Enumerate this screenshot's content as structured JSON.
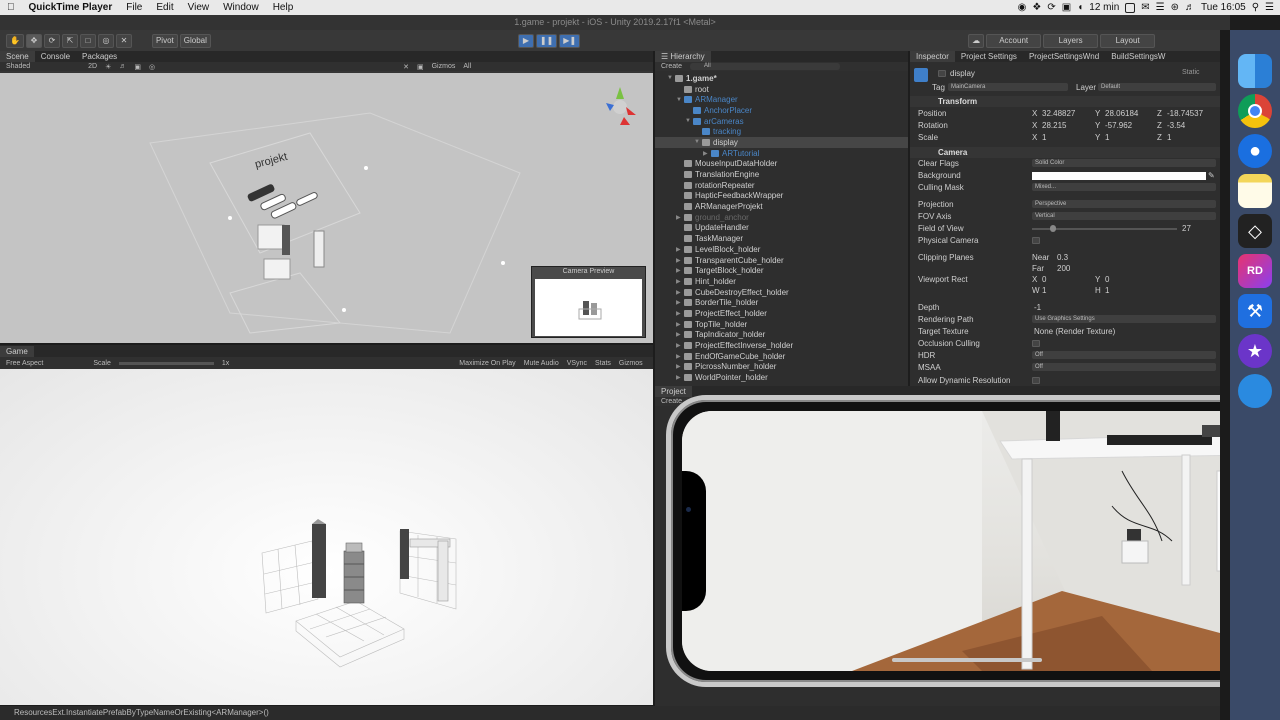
{
  "menubar": {
    "app": "QuickTime Player",
    "items": [
      "File",
      "Edit",
      "View",
      "Window",
      "Help"
    ],
    "status": {
      "timer": "12 min",
      "time": "Tue 16:05"
    }
  },
  "window_title": "1.game - projekt - iOS - Unity 2019.2.17f1 <Metal>",
  "toolbar": {
    "pivot": "Pivot",
    "global": "Global",
    "account": "Account",
    "layers": "Layers",
    "layout": "Layout"
  },
  "scene_panel": {
    "tabs": [
      "Scene",
      "Console",
      "Packages"
    ],
    "shading": "Shaded",
    "mode2d": "2D",
    "gizmos": "Gizmos",
    "all": "All",
    "camera_preview": "Camera Preview",
    "sign_text": "projekt"
  },
  "game_panel": {
    "tab": "Game",
    "aspect": "Free Aspect",
    "scale_label": "Scale",
    "scale_value": "1x",
    "options": [
      "Maximize On Play",
      "Mute Audio",
      "VSync",
      "Stats",
      "Gizmos"
    ]
  },
  "hierarchy": {
    "tab": "Hierarchy",
    "create": "Create",
    "search": "All",
    "rows": [
      {
        "label": "1.game*",
        "indent": 0,
        "style": "head",
        "arrow": "▼"
      },
      {
        "label": "root",
        "indent": 1,
        "style": "",
        "arrow": ""
      },
      {
        "label": "ARManager",
        "indent": 1,
        "style": "blue",
        "arrow": "▼"
      },
      {
        "label": "AnchorPlacer",
        "indent": 2,
        "style": "blue",
        "arrow": ""
      },
      {
        "label": "arCameras",
        "indent": 2,
        "style": "blue",
        "arrow": "▼"
      },
      {
        "label": "tracking",
        "indent": 3,
        "style": "blue",
        "arrow": ""
      },
      {
        "label": "display",
        "indent": 3,
        "style": "sel",
        "arrow": "▼"
      },
      {
        "label": "ARTutorial",
        "indent": 4,
        "style": "blue",
        "arrow": "▶"
      },
      {
        "label": "MouseInputDataHolder",
        "indent": 1,
        "style": "",
        "arrow": ""
      },
      {
        "label": "TranslationEngine",
        "indent": 1,
        "style": "",
        "arrow": ""
      },
      {
        "label": "rotationRepeater",
        "indent": 1,
        "style": "",
        "arrow": ""
      },
      {
        "label": "HapticFeedbackWrapper",
        "indent": 1,
        "style": "",
        "arrow": ""
      },
      {
        "label": "ARManagerProjekt",
        "indent": 1,
        "style": "",
        "arrow": ""
      },
      {
        "label": "ground_anchor",
        "indent": 1,
        "style": "dim",
        "arrow": "▶"
      },
      {
        "label": "UpdateHandler",
        "indent": 1,
        "style": "",
        "arrow": ""
      },
      {
        "label": "TaskManager",
        "indent": 1,
        "style": "",
        "arrow": ""
      },
      {
        "label": "LevelBlock_holder",
        "indent": 1,
        "style": "",
        "arrow": "▶"
      },
      {
        "label": "TransparentCube_holder",
        "indent": 1,
        "style": "",
        "arrow": "▶"
      },
      {
        "label": "TargetBlock_holder",
        "indent": 1,
        "style": "",
        "arrow": "▶"
      },
      {
        "label": "Hint_holder",
        "indent": 1,
        "style": "",
        "arrow": "▶"
      },
      {
        "label": "CubeDestroyEffect_holder",
        "indent": 1,
        "style": "",
        "arrow": "▶"
      },
      {
        "label": "BorderTile_holder",
        "indent": 1,
        "style": "",
        "arrow": "▶"
      },
      {
        "label": "ProjectEffect_holder",
        "indent": 1,
        "style": "",
        "arrow": "▶"
      },
      {
        "label": "TopTile_holder",
        "indent": 1,
        "style": "",
        "arrow": "▶"
      },
      {
        "label": "TapIndicator_holder",
        "indent": 1,
        "style": "",
        "arrow": "▶"
      },
      {
        "label": "ProjectEffectInverse_holder",
        "indent": 1,
        "style": "",
        "arrow": "▶"
      },
      {
        "label": "EndOfGameCube_holder",
        "indent": 1,
        "style": "",
        "arrow": "▶"
      },
      {
        "label": "PicrossNumber_holder",
        "indent": 1,
        "style": "",
        "arrow": "▶"
      },
      {
        "label": "WorldPointer_holder",
        "indent": 1,
        "style": "",
        "arrow": "▶"
      }
    ]
  },
  "inspector": {
    "tabs": [
      "Inspector",
      "Project Settings",
      "ProjectSettingsWnd",
      "BuildSettingsW"
    ],
    "object_name": "display",
    "static": "Static",
    "tag_label": "Tag",
    "tag": "MainCamera",
    "layer_label": "Layer",
    "layer": "Default",
    "transform": {
      "title": "Transform",
      "position": {
        "label": "Position",
        "x": "32.48827",
        "y": "28.06184",
        "z": "-18.74537"
      },
      "rotation": {
        "label": "Rotation",
        "x": "28.215",
        "y": "-57.962",
        "z": "-3.54"
      },
      "scale": {
        "label": "Scale",
        "x": "1",
        "y": "1",
        "z": "1"
      }
    },
    "camera": {
      "title": "Camera",
      "clear_flags": {
        "label": "Clear Flags",
        "value": "Solid Color"
      },
      "background": {
        "label": "Background",
        "color": "#ffffff"
      },
      "culling_mask": {
        "label": "Culling Mask",
        "value": "Mixed..."
      },
      "projection": {
        "label": "Projection",
        "value": "Perspective"
      },
      "fov_axis": {
        "label": "FOV Axis",
        "value": "Vertical"
      },
      "field_of_view": {
        "label": "Field of View",
        "value": "27"
      },
      "physical_camera": {
        "label": "Physical Camera"
      },
      "clipping": {
        "label": "Clipping Planes",
        "near_label": "Near",
        "near": "0.3",
        "far_label": "Far",
        "far": "200"
      },
      "viewport": {
        "label": "Viewport Rect",
        "x": "0",
        "y": "0",
        "w": "1",
        "h": "1"
      },
      "depth": {
        "label": "Depth",
        "value": "-1"
      },
      "rendering_path": {
        "label": "Rendering Path",
        "value": "Use Graphics Settings"
      },
      "target_texture": {
        "label": "Target Texture",
        "value": "None (Render Texture)"
      },
      "occlusion": {
        "label": "Occlusion Culling"
      },
      "hdr": {
        "label": "HDR",
        "value": "Off"
      },
      "msaa": {
        "label": "MSAA",
        "value": "Off"
      },
      "dynamic_res": {
        "label": "Allow Dynamic Resolution"
      }
    }
  },
  "project_panel": {
    "tab": "Project",
    "create": "Create"
  },
  "console_message": "ResourcesExt.InstantiatePrefabByTypeNameOrExisting<ARManager>()",
  "dock_icons": [
    "finder-icon",
    "chrome-icon",
    "maps-pin-icon",
    "notes-icon",
    "unity-icon",
    "rider-icon",
    "xcode-icon",
    "imovie-icon",
    "app-icon"
  ]
}
